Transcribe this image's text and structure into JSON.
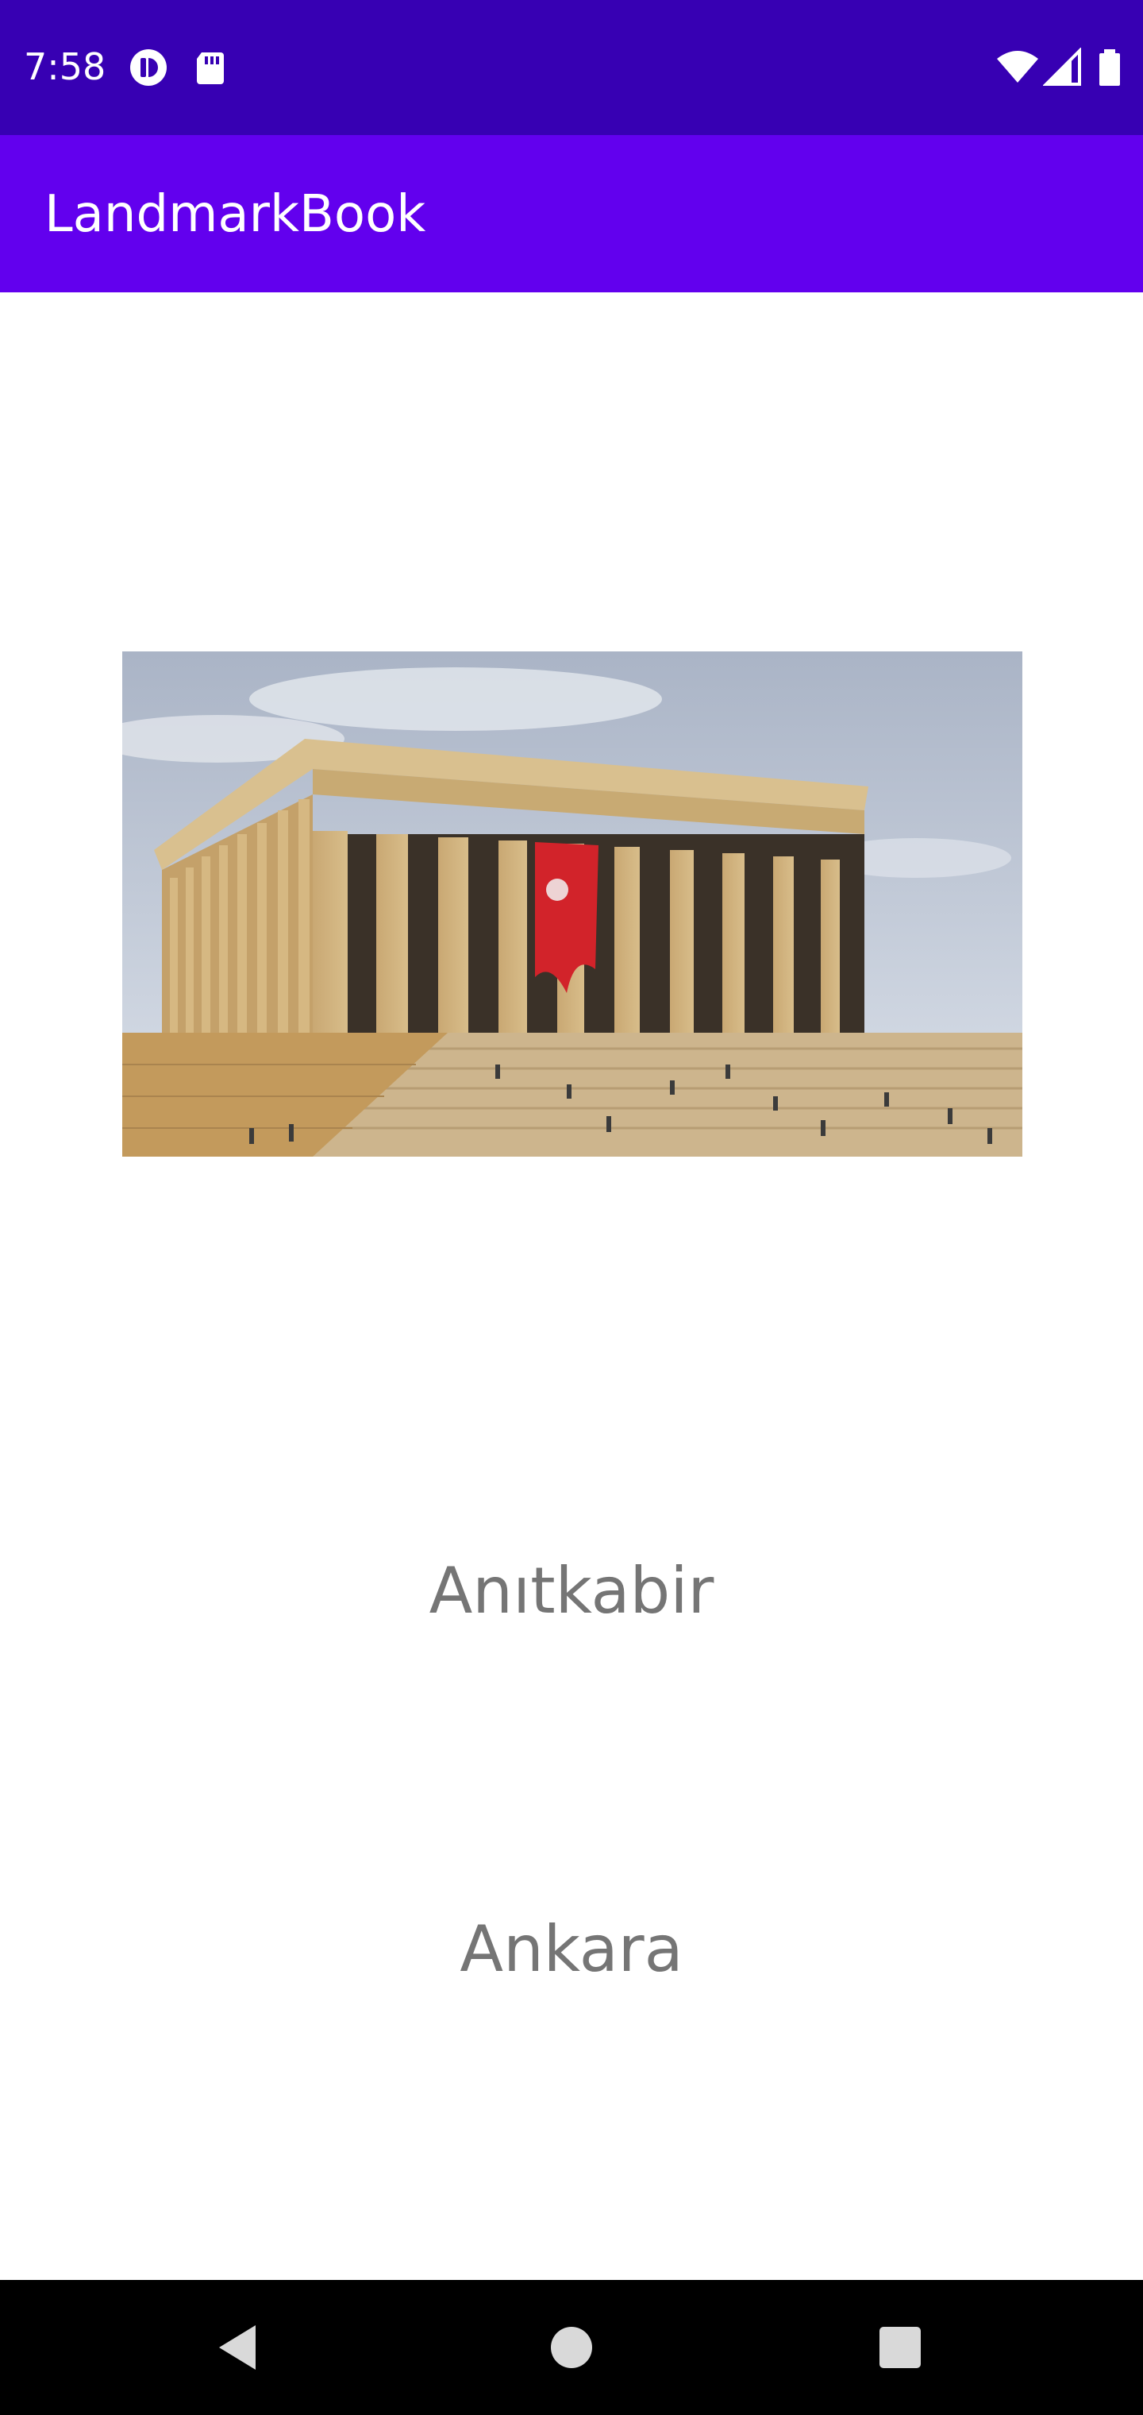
{
  "status_bar": {
    "time": "7:58",
    "background": "#3700b3",
    "icons": [
      "vpn-key-icon",
      "sd-card-icon",
      "wifi-icon",
      "cell-signal-icon",
      "battery-icon"
    ]
  },
  "app_bar": {
    "title": "LandmarkBook",
    "background": "#6200ee"
  },
  "landmark": {
    "image_subject": "Anitkabir mausoleum photo",
    "name": "Anıtkabir",
    "city": "Ankara",
    "text_color": "#757575"
  },
  "nav_bar": {
    "icons": [
      "back-triangle-icon",
      "home-circle-icon",
      "recents-square-icon"
    ],
    "background": "#000000"
  }
}
